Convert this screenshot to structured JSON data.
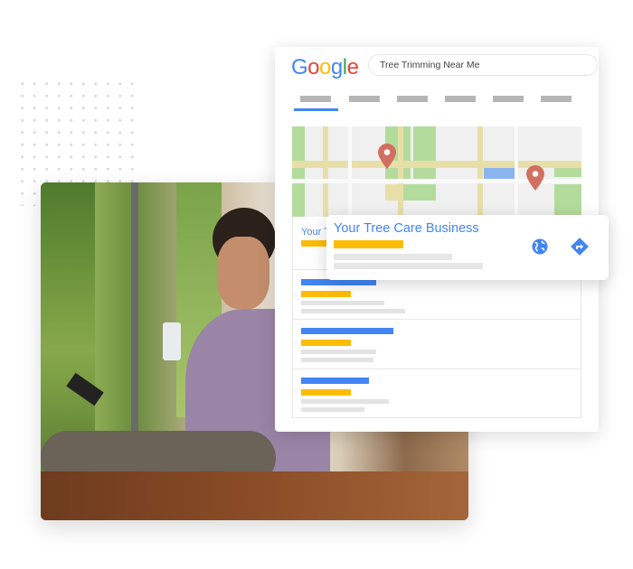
{
  "search_card": {
    "logo": "Google",
    "logo_colors": [
      "#4285f4",
      "#ea4335",
      "#fbbc05",
      "#4285f4",
      "#34a853",
      "#ea4335"
    ],
    "query": "Tree Trimming Near Me",
    "active_tab_index": 0,
    "first_result_title": "Your T"
  },
  "business_card": {
    "title": "Your Tree Care Business",
    "icons": [
      "globe-icon",
      "directions-icon"
    ]
  },
  "colors": {
    "accent": "#4285f4",
    "yellow": "#fbbc05",
    "pin": "#d2705f",
    "park": "#b3dc9c",
    "road": "#e8dfa8"
  }
}
